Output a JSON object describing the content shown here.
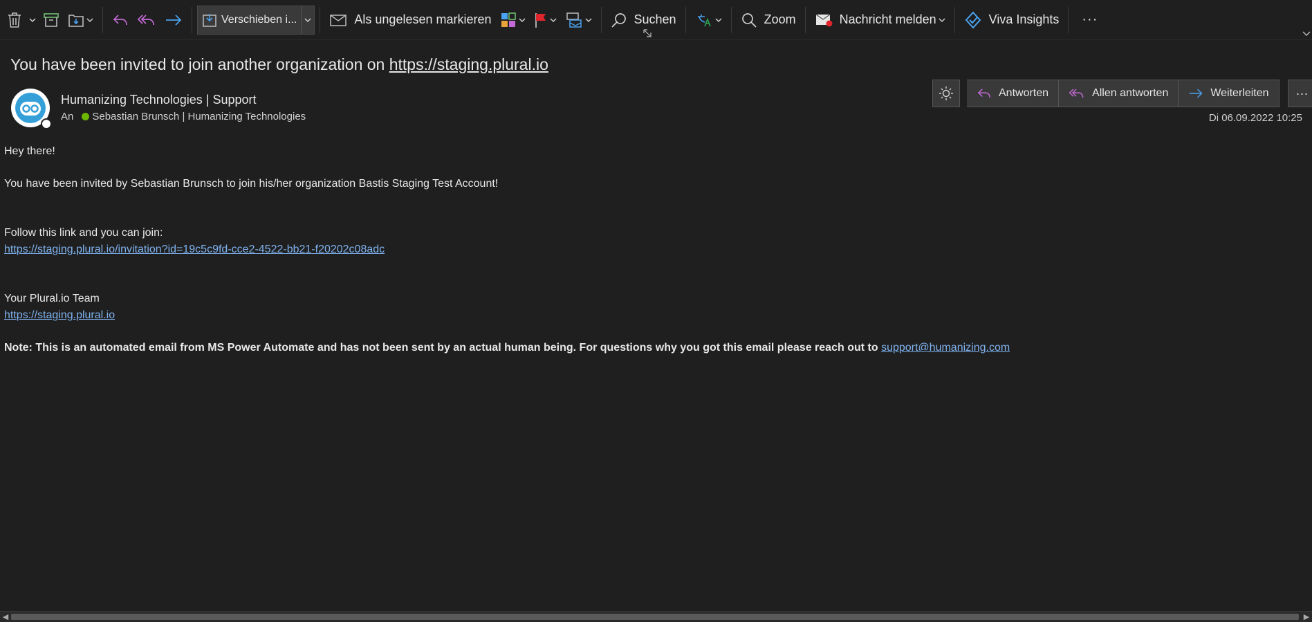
{
  "toolbar": {
    "move_label": "Verschieben i...",
    "mark_unread_label": "Als ungelesen markieren",
    "search_label": "Suchen",
    "zoom_label": "Zoom",
    "report_label": "Nachricht melden",
    "viva_label": "Viva Insights",
    "more_glyph": "···"
  },
  "email": {
    "subject_prefix": "You have been invited to join another organization on ",
    "subject_link": "https://staging.plural.io",
    "sender_name": "Humanizing Technologies | Support",
    "to_prefix": "An",
    "recipient": "Sebastian Brunsch | Humanizing Technologies",
    "date": "Di 06.09.2022 10:25"
  },
  "actions": {
    "reply": "Antworten",
    "reply_all": "Allen antworten",
    "forward": "Weiterleiten",
    "more_glyph": "···"
  },
  "body": {
    "greeting": "Hey there!",
    "invite_line": "You have been invited by Sebastian Brunsch to join his/her organization Bastis Staging Test Account!",
    "follow_line": "Follow this link and you can join:",
    "invite_link": "https://staging.plural.io/invitation?id=19c5c9fd-cce2-4522-bb21-f20202c08adc",
    "signoff": "Your Plural.io Team",
    "site_link": "https://staging.plural.io",
    "note": "Note: This is an automated email from MS Power Automate and has not been sent by an actual human being. For questions why you got this email please reach out to ",
    "support_email": "support@humanizing.com"
  },
  "colors": {
    "background": "#1f1f1f",
    "link": "#7fb2ee",
    "purple_icon": "#c36ad6",
    "blue_icon": "#4aa3f0",
    "flag_red": "#e0242c",
    "status_green": "#6bb700"
  }
}
